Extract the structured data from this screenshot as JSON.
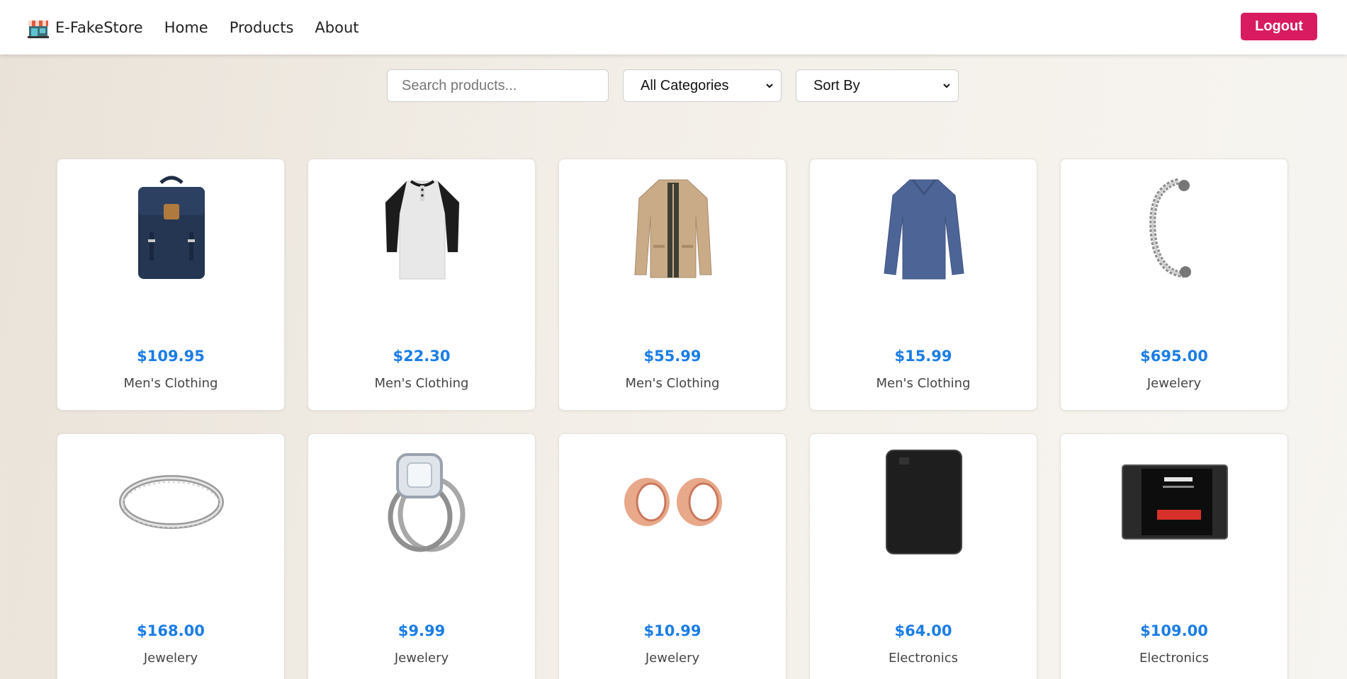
{
  "nav": {
    "brand": "E-FakeStore",
    "links": [
      "Home",
      "Products",
      "About"
    ],
    "logout_label": "Logout"
  },
  "filters": {
    "search_placeholder": "Search products...",
    "category_selected": "All Categories",
    "sort_selected": "Sort By"
  },
  "colors": {
    "accent": "#d81b60",
    "price": "#1a7de6"
  },
  "products": [
    {
      "price": "$109.95",
      "category": "Men's Clothing",
      "image": "backpack"
    },
    {
      "price": "$22.30",
      "category": "Men's Clothing",
      "image": "raglan-tee"
    },
    {
      "price": "$55.99",
      "category": "Men's Clothing",
      "image": "jacket"
    },
    {
      "price": "$15.99",
      "category": "Men's Clothing",
      "image": "long-sleeve-shirt"
    },
    {
      "price": "$695.00",
      "category": "Jewelery",
      "image": "chain-bracelet"
    },
    {
      "price": "$168.00",
      "category": "Jewelery",
      "image": "silver-ring"
    },
    {
      "price": "$9.99",
      "category": "Jewelery",
      "image": "diamond-ring"
    },
    {
      "price": "$10.99",
      "category": "Jewelery",
      "image": "rose-gold-plugs"
    },
    {
      "price": "$64.00",
      "category": "Electronics",
      "image": "external-hard-drive"
    },
    {
      "price": "$109.00",
      "category": "Electronics",
      "image": "ssd"
    }
  ]
}
